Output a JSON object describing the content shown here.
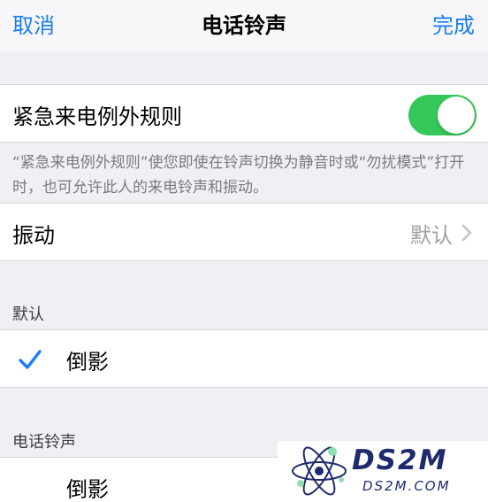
{
  "navbar": {
    "cancel_label": "取消",
    "title": "电话铃声",
    "done_label": "完成"
  },
  "emergency_bypass": {
    "label": "紧急来电例外规则",
    "enabled": true,
    "footnote": "“紧急来电例外规则”使您即使在铃声切换为静音时或“勿扰模式”打开时，也可允许此人的来电铃声和振动。"
  },
  "vibration": {
    "label": "振动",
    "value": "默认"
  },
  "default_section": {
    "header": "默认",
    "selected_ringtone": "倒影"
  },
  "ringtones_section": {
    "header": "电话铃声",
    "items": [
      "倒影"
    ]
  },
  "watermark": {
    "brand": "DS2M",
    "domain": "DS2M.COM"
  },
  "colors": {
    "accent": "#1a7cf5",
    "toggle_on": "#35c759",
    "background": "#efeff4"
  },
  "icons": {
    "checkmark": "checkmark-icon",
    "chevron": "chevron-right-icon",
    "logo": "atom-logo-icon"
  }
}
